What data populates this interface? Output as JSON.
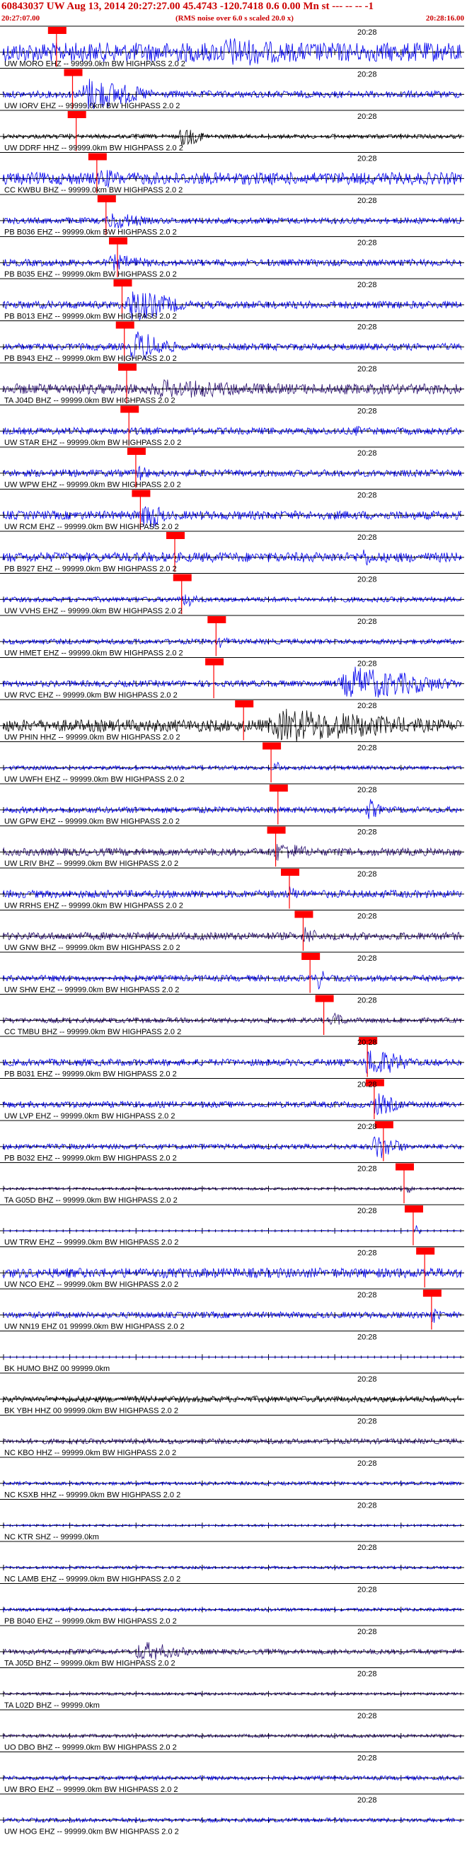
{
  "header": {
    "title": "60843037 UW Aug 13, 2014 20:27:27.00    45.4743 -120.7418  0.6 0.00 Mn st --- -- --  -1",
    "start_time": "20:27:07.00",
    "note": "(RMS noise over 6.0 s scaled 20.0 x)",
    "end_time": "20:28:16.00"
  },
  "chart_data": {
    "type": "seismogram",
    "time_start": "20:27:07.00",
    "time_end": "20:28:16.00",
    "time_marker_label": "20:28",
    "colors": {
      "axis": "#000000",
      "pick": "#ff0000",
      "blue": "#0000ee",
      "purple": "#2a1070",
      "black": "#000000"
    },
    "pick_label": "P",
    "traces": [
      {
        "label": "UW MORO EHZ -- 99999.0km BW  HIGHPASS  2.0  2",
        "color": "blue",
        "pick": 0.117,
        "amp": 0.55,
        "burst": [
          0.45,
          0.72
        ],
        "burst_amp": 0.9
      },
      {
        "label": "UW IORV EHZ -- 99999.0km BW  HIGHPASS  2.0  2",
        "color": "blue",
        "pick": 0.152,
        "amp": 0.2,
        "burst": [
          0.16,
          0.33
        ],
        "burst_amp": 1.0
      },
      {
        "label": "UW DDRF HHZ -- 99999.0km BW  HIGHPASS  2.0  2",
        "color": "black",
        "pick": 0.16,
        "amp": 0.12,
        "burst": [
          0.38,
          0.45
        ],
        "burst_amp": 0.6
      },
      {
        "label": "CC KWBU BHZ -- 99999.0km BW  HIGHPASS  2.0  2",
        "color": "blue",
        "pick": 0.205,
        "amp": 0.35,
        "burst": [
          0.2,
          0.3
        ],
        "burst_amp": 0.6
      },
      {
        "label": "PB B036 EHZ -- 99999.0km BW  HIGHPASS  2.0  2",
        "color": "blue",
        "pick": 0.225,
        "amp": 0.18,
        "burst": [
          0.22,
          0.33
        ],
        "burst_amp": 0.55
      },
      {
        "label": "PB B035 EHZ -- 99999.0km BW  HIGHPASS  2.0  2",
        "color": "blue",
        "pick": 0.25,
        "amp": 0.2,
        "burst": [
          0.22,
          0.35
        ],
        "burst_amp": 0.5
      },
      {
        "label": "PB B013 EHZ -- 99999.0km BW  HIGHPASS  2.0  2",
        "color": "blue",
        "pick": 0.26,
        "amp": 0.22,
        "burst": [
          0.26,
          0.4
        ],
        "burst_amp": 1.0
      },
      {
        "label": "PB B943 EHZ -- 99999.0km BW  HIGHPASS  2.0  2",
        "color": "blue",
        "pick": 0.265,
        "amp": 0.2,
        "burst": [
          0.27,
          0.38
        ],
        "burst_amp": 1.0
      },
      {
        "label": "TA J04D BHZ -- 99999.0km BW  HIGHPASS  2.0  2",
        "color": "purple",
        "pick": 0.27,
        "amp": 0.3,
        "burst": [
          0.28,
          0.75
        ],
        "burst_amp": 0.55
      },
      {
        "label": "UW STAR EHZ -- 99999.0km BW  HIGHPASS  2.0  2",
        "color": "blue",
        "pick": 0.275,
        "amp": 0.2,
        "burst": [
          0.76,
          0.8
        ],
        "burst_amp": 0.35
      },
      {
        "label": "UW WPW EHZ -- 99999.0km BW  HIGHPASS  2.0  2",
        "color": "blue",
        "pick": 0.29,
        "amp": 0.2,
        "burst": [
          0.29,
          0.33
        ],
        "burst_amp": 0.5
      },
      {
        "label": "UW RCM EHZ -- 99999.0km BW  HIGHPASS  2.0  2",
        "color": "blue",
        "pick": 0.3,
        "amp": 0.25,
        "burst": [
          0.3,
          0.36
        ],
        "burst_amp": 1.0
      },
      {
        "label": "PB B927 EHZ -- 99999.0km BW  HIGHPASS  2.0  2",
        "color": "blue",
        "pick": 0.375,
        "amp": 0.28,
        "burst": [
          0.78,
          0.82
        ],
        "burst_amp": 0.6
      },
      {
        "label": "UW VVHS EHZ -- 99999.0km BW  HIGHPASS  2.0  2",
        "color": "blue",
        "pick": 0.39,
        "amp": 0.15,
        "burst": [
          0.39,
          0.43
        ],
        "burst_amp": 0.5
      },
      {
        "label": "UW HMET EHZ -- 99999.0km BW  HIGHPASS  2.0  2",
        "color": "blue",
        "pick": 0.465,
        "amp": 0.15,
        "burst": [
          0.47,
          0.5
        ],
        "burst_amp": 0.4
      },
      {
        "label": "UW RVC EHZ -- 99999.0km BW  HIGHPASS  2.0  2",
        "color": "blue",
        "pick": 0.46,
        "amp": 0.18,
        "burst": [
          0.72,
          0.99
        ],
        "burst_amp": 1.0
      },
      {
        "label": "UW PHIN HHZ -- 99999.0km BW  HIGHPASS  2.0  2",
        "color": "black",
        "pick": 0.525,
        "amp": 0.35,
        "burst": [
          0.55,
          0.99
        ],
        "burst_amp": 1.0
      },
      {
        "label": "UW UWFH EHZ -- 99999.0km BW  HIGHPASS  2.0  2",
        "color": "blue",
        "pick": 0.585,
        "amp": 0.12,
        "burst": [
          0.59,
          0.61
        ],
        "burst_amp": 0.5
      },
      {
        "label": "UW GPW EHZ -- 99999.0km BW  HIGHPASS  2.0  2",
        "color": "blue",
        "pick": 0.6,
        "amp": 0.18,
        "burst": [
          0.79,
          0.83
        ],
        "burst_amp": 0.7
      },
      {
        "label": "UW LRIV BHZ -- 99999.0km BW  HIGHPASS  2.0  2",
        "color": "purple",
        "pick": 0.595,
        "amp": 0.22,
        "burst": [
          0.58,
          0.7
        ],
        "burst_amp": 0.6
      },
      {
        "label": "UW RRHS EHZ -- 99999.0km BW  HIGHPASS  2.0  2",
        "color": "blue",
        "pick": 0.625,
        "amp": 0.22,
        "burst": [
          0.62,
          0.66
        ],
        "burst_amp": 0.45
      },
      {
        "label": "UW GNW BHZ -- 99999.0km BW  HIGHPASS  2.0  2",
        "color": "purple",
        "pick": 0.655,
        "amp": 0.22,
        "burst": [
          0.65,
          0.7
        ],
        "burst_amp": 0.6
      },
      {
        "label": "UW SHW EHZ -- 99999.0km BW  HIGHPASS  2.0  2",
        "color": "blue",
        "pick": 0.67,
        "amp": 0.18,
        "burst": [
          0.68,
          0.71
        ],
        "burst_amp": 0.7
      },
      {
        "label": "CC TMBU BHZ -- 99999.0km BW  HIGHPASS  2.0  2",
        "color": "purple",
        "pick": 0.7,
        "amp": 0.15,
        "burst": [
          0.71,
          0.76
        ],
        "burst_amp": 0.5
      },
      {
        "label": "PB B031 EHZ -- 99999.0km BW  HIGHPASS  2.0  2",
        "color": "blue",
        "pick": 0.795,
        "amp": 0.2,
        "burst": [
          0.78,
          0.9
        ],
        "burst_amp": 0.9
      },
      {
        "label": "UW LVP EHZ -- 99999.0km BW  HIGHPASS  2.0  2",
        "color": "blue",
        "pick": 0.81,
        "amp": 0.18,
        "burst": [
          0.8,
          0.88
        ],
        "burst_amp": 0.7
      },
      {
        "label": "PB B032 EHZ -- 99999.0km BW  HIGHPASS  2.0  2",
        "color": "blue",
        "pick": 0.83,
        "amp": 0.15,
        "burst": [
          0.8,
          0.88
        ],
        "burst_amp": 0.8
      },
      {
        "label": "TA G05D BHZ -- 99999.0km BW  HIGHPASS  2.0  2",
        "color": "purple",
        "pick": 0.875,
        "amp": 0.08,
        "burst": [
          0.88,
          0.9
        ],
        "burst_amp": 0.3
      },
      {
        "label": "UW TRW EHZ -- 99999.0km BW  HIGHPASS  2.0  2",
        "color": "blue",
        "pick": 0.895,
        "amp": 0.02,
        "burst": [
          0.9,
          0.91
        ],
        "burst_amp": 0.6
      },
      {
        "label": "UW NCO EHZ -- 99999.0km BW  HIGHPASS  2.0  2",
        "color": "blue",
        "pick": 0.92,
        "amp": 0.28,
        "burst": [
          0.92,
          0.95
        ],
        "burst_amp": 0.5
      },
      {
        "label": "UW NN19 EHZ 01 99999.0km BW  HIGHPASS  2.0  2",
        "color": "blue",
        "pick": 0.935,
        "amp": 0.18,
        "burst": [
          0.93,
          0.96
        ],
        "burst_amp": 0.6
      },
      {
        "label": "BK HUMO BHZ 00 99999.0km",
        "color": "blue",
        "pick": null,
        "amp": 0.0,
        "burst": null,
        "burst_amp": 0
      },
      {
        "label": "BK YBH HHZ 00 99999.0km BW  HIGHPASS  2.0  2",
        "color": "black",
        "pick": null,
        "amp": 0.18,
        "burst": null,
        "burst_amp": 0
      },
      {
        "label": "NC KBO HHZ -- 99999.0km BW  HIGHPASS  2.0  2",
        "color": "purple",
        "pick": null,
        "amp": 0.15,
        "burst": null,
        "burst_amp": 0
      },
      {
        "label": "NC KSXB HHZ -- 99999.0km BW  HIGHPASS  2.0  2",
        "color": "blue",
        "pick": null,
        "amp": 0.1,
        "burst": null,
        "burst_amp": 0
      },
      {
        "label": "NC KTR SHZ -- 99999.0km",
        "color": "blue",
        "pick": null,
        "amp": 0.05,
        "burst": null,
        "burst_amp": 0
      },
      {
        "label": "NC LAMB EHZ -- 99999.0km BW  HIGHPASS  2.0  2",
        "color": "blue",
        "pick": null,
        "amp": 0.08,
        "burst": null,
        "burst_amp": 0
      },
      {
        "label": "PB B040 EHZ -- 99999.0km BW  HIGHPASS  2.0  2",
        "color": "blue",
        "pick": null,
        "amp": 0.1,
        "burst": null,
        "burst_amp": 0
      },
      {
        "label": "TA J05D BHZ -- 99999.0km BW  HIGHPASS  2.0  2",
        "color": "purple",
        "pick": null,
        "amp": 0.15,
        "burst": [
          0.28,
          0.42
        ],
        "burst_amp": 0.6
      },
      {
        "label": "TA L02D BHZ -- 99999.0km",
        "color": "purple",
        "pick": null,
        "amp": 0.08,
        "burst": null,
        "burst_amp": 0
      },
      {
        "label": "UO DBO BHZ -- 99999.0km BW  HIGHPASS  2.0  2",
        "color": "purple",
        "pick": null,
        "amp": 0.1,
        "burst": null,
        "burst_amp": 0
      },
      {
        "label": "UW BRO EHZ -- 99999.0km BW  HIGHPASS  2.0  2",
        "color": "blue",
        "pick": null,
        "amp": 0.12,
        "burst": null,
        "burst_amp": 0
      },
      {
        "label": "UW HOG EHZ -- 99999.0km BW  HIGHPASS  2.0  2",
        "color": "blue",
        "pick": null,
        "amp": 0.12,
        "burst": null,
        "burst_amp": 0
      }
    ]
  }
}
